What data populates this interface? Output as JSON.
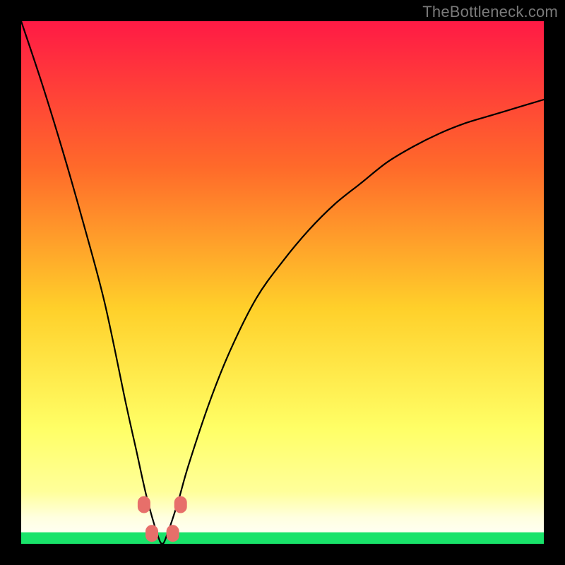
{
  "watermark": "TheBottleneck.com",
  "colors": {
    "frame": "#000000",
    "curve": "#000000",
    "marker_fill": "#e76f6a",
    "marker_stroke": "#c24545",
    "green_band": "#19e36a",
    "gradient_top": "#ff1a45",
    "gradient_mid1": "#ff7a2a",
    "gradient_mid2": "#ffd02a",
    "gradient_mid3": "#ffff66",
    "gradient_pale": "#ffffcc"
  },
  "chart_data": {
    "type": "line",
    "title": "",
    "xlabel": "",
    "ylabel": "",
    "xlim": [
      0,
      100
    ],
    "ylim": [
      0,
      100
    ],
    "grid": false,
    "legend": false,
    "description": "Bottleneck-percentage style V-curve on a red→yellow→green vertical gradient background. The curve drops steeply from top-left, bottoms out near x≈27 at y≈0, then rises with a concave shape toward the right edge reaching roughly y≈85 at x=100. A thin bright green band marks y≈0–2. Four rounded salmon markers sit near the trough.",
    "series": [
      {
        "name": "bottleneck_curve",
        "x": [
          0,
          4,
          8,
          12,
          16,
          20,
          22,
          24,
          26,
          27,
          28,
          30,
          32,
          36,
          40,
          45,
          50,
          55,
          60,
          65,
          70,
          75,
          80,
          85,
          90,
          95,
          100
        ],
        "y": [
          100,
          88,
          75,
          61,
          46,
          27,
          18,
          9,
          2,
          0,
          2,
          8,
          15,
          27,
          37,
          47,
          54,
          60,
          65,
          69,
          73,
          76,
          78.5,
          80.5,
          82,
          83.5,
          85
        ]
      }
    ],
    "markers": [
      {
        "x": 23.5,
        "y": 7.5
      },
      {
        "x": 30.5,
        "y": 7.5
      },
      {
        "x": 25.0,
        "y": 2.0
      },
      {
        "x": 29.0,
        "y": 2.0
      }
    ],
    "green_band_y": [
      0,
      2.2
    ]
  }
}
